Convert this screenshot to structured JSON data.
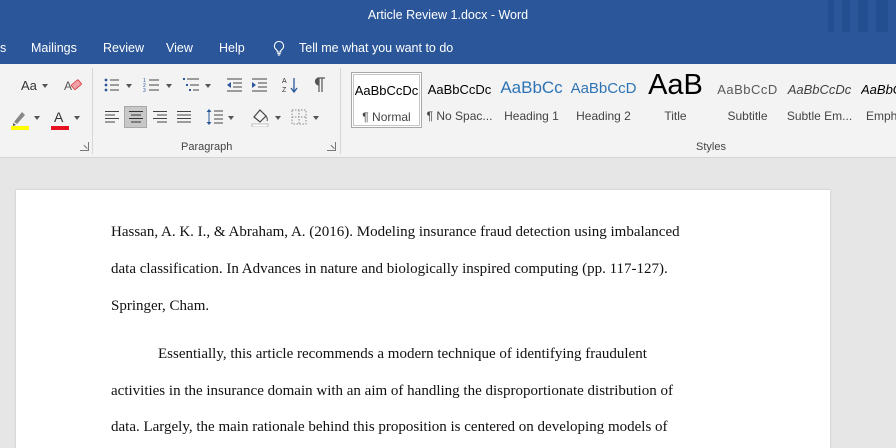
{
  "window": {
    "title": "Article Review 1.docx  -  Word"
  },
  "tabs": {
    "partial_left": "s",
    "mailings": "Mailings",
    "review": "Review",
    "view": "View",
    "help": "Help",
    "tell_me": "Tell me what you want to do"
  },
  "ribbon": {
    "font_case_label": "Aa",
    "paragraph_group_label": "Paragraph",
    "styles_group_label": "Styles",
    "styles": [
      {
        "preview": "AaBbCcDc",
        "label": "¶ Normal"
      },
      {
        "preview": "AaBbCcDc",
        "label": "¶ No Spac..."
      },
      {
        "preview": "AaBbCc",
        "label": "Heading 1"
      },
      {
        "preview": "AaBbCcD",
        "label": "Heading 2"
      },
      {
        "preview": "AaB",
        "label": "Title"
      },
      {
        "preview": "AaBbCcD",
        "label": "Subtitle"
      },
      {
        "preview": "AaBbCcDc",
        "label": "Subtle Em..."
      },
      {
        "preview": "AaBbCcDc",
        "label": "Emph"
      }
    ],
    "colors": {
      "highlight": "#ffff00",
      "font_color": "#e81123",
      "accent": "#2b579a"
    }
  },
  "document": {
    "lines": [
      "Hassan, A. K. I., & Abraham, A. (2016). Modeling insurance fraud detection using imbalanced",
      "data classification. In Advances in nature and biologically inspired computing (pp. 117-127).",
      "Springer, Cham.",
      "Essentially, this article recommends a modern technique of identifying fraudulent",
      "activities in the insurance domain with an aim of handling the disproportionate distribution of",
      "data. Largely, the main rationale behind this proposition is centered on developing models of"
    ]
  }
}
